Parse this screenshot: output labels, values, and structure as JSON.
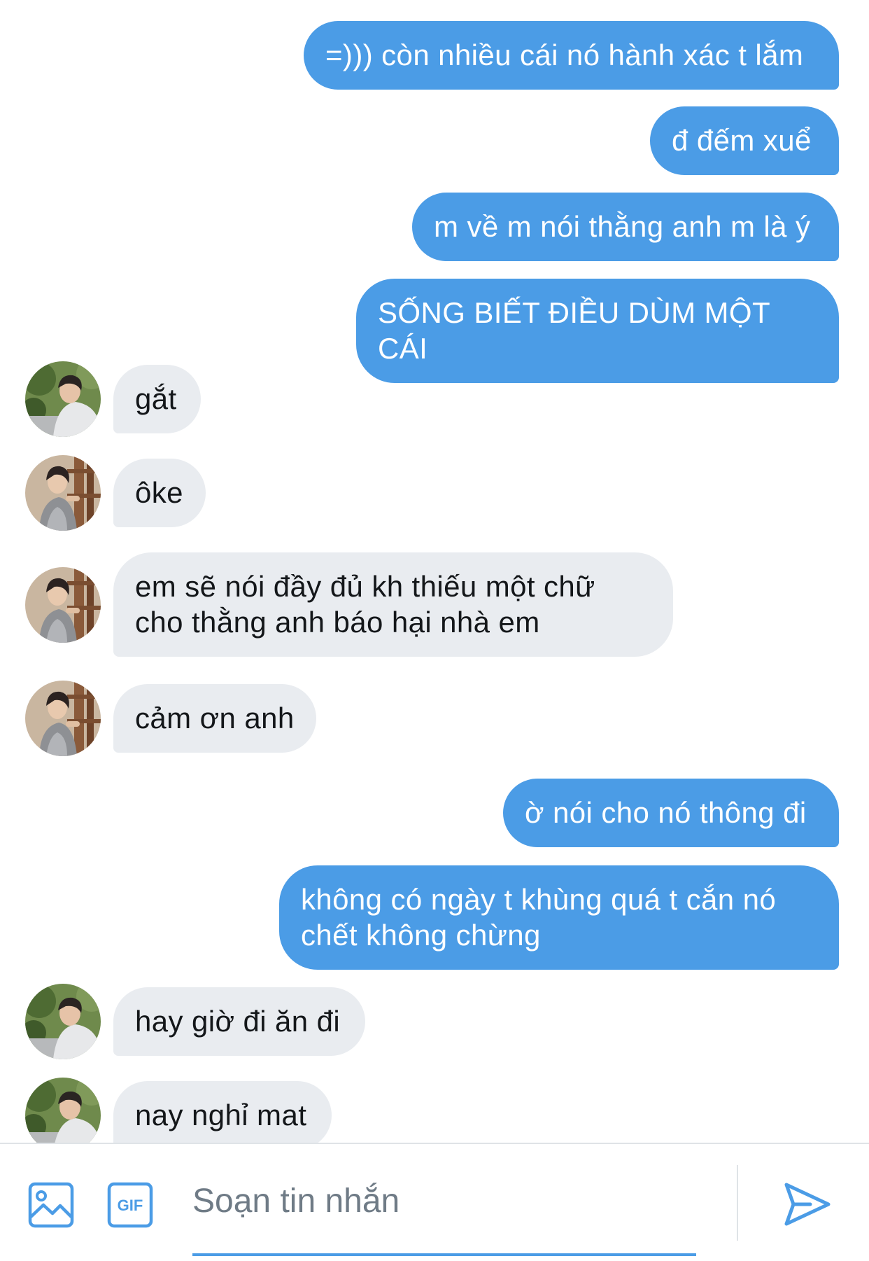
{
  "messages": [
    {
      "direction": "out",
      "text": "=))) còn nhiều cái nó hành xác t lắm"
    },
    {
      "direction": "out",
      "text": "đ đếm xuể"
    },
    {
      "direction": "out",
      "text": "m về m nói thằng anh m là ý"
    },
    {
      "direction": "out",
      "text": "SỐNG BIẾT ĐIỀU DÙM MỘT CÁI"
    },
    {
      "direction": "in",
      "text": "gắt",
      "avatar": "avatar-outdoor"
    },
    {
      "direction": "in",
      "text": "ôke",
      "avatar": "avatar-indoor"
    },
    {
      "direction": "in",
      "text": "em sẽ nói đầy đủ kh thiếu một chữ\ncho thằng anh báo hại nhà em",
      "avatar": "avatar-indoor"
    },
    {
      "direction": "in",
      "text": "cảm ơn anh",
      "avatar": "avatar-indoor"
    },
    {
      "direction": "out",
      "text": "ờ nói cho nó thông đi"
    },
    {
      "direction": "out",
      "text": "không có ngày t khùng quá t cắn nó\nchết không chừng"
    },
    {
      "direction": "in",
      "text": "hay giờ đi ăn đi",
      "avatar": "avatar-outdoor"
    },
    {
      "direction": "in",
      "text": "nay nghỉ mat",
      "avatar": "avatar-outdoor"
    }
  ],
  "composer": {
    "placeholder": "Soạn tin nhắn",
    "image_button_icon": "image-icon",
    "gif_button_icon": "gif-icon",
    "gif_label": "GIF",
    "send_button_icon": "send-icon"
  },
  "colors": {
    "outgoing_bubble": "#4b9ce6",
    "incoming_bubble": "#e9ecf0",
    "accent": "#4b9ce6"
  }
}
